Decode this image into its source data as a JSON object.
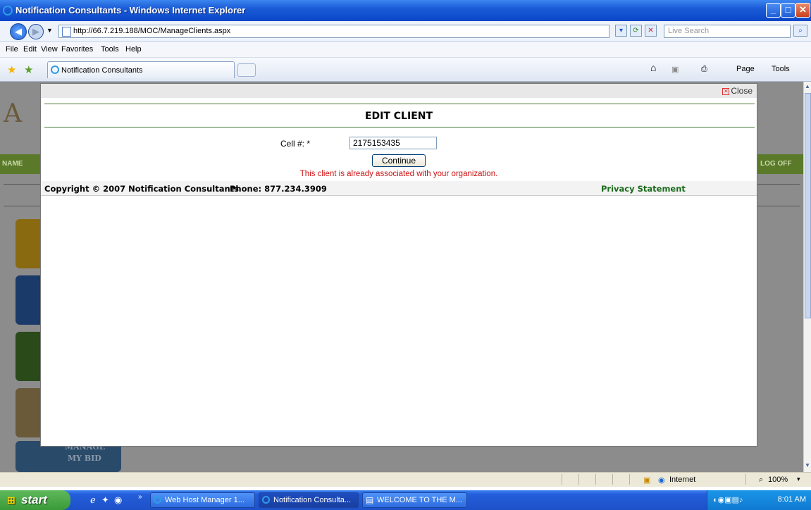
{
  "window": {
    "title": "Notification Consultants - Windows Internet Explorer",
    "minimize": "_",
    "maximize": "□",
    "close": "✕"
  },
  "addressbar": {
    "url": "http://66.7.219.188/MOC/ManageClients.aspx",
    "search_placeholder": "Live Search"
  },
  "menu": {
    "items": [
      "File",
      "Edit",
      "View",
      "Favorites",
      "Tools",
      "Help"
    ]
  },
  "tabs": {
    "active_label": "Notification Consultants"
  },
  "commandbar": {
    "page_label": "Page",
    "tools_label": "Tools"
  },
  "background_page": {
    "nav_left": "NAME",
    "logoff": "LOG OFF",
    "tile_label_1": "MANAGE",
    "tile_label_2": "MY BID"
  },
  "modal": {
    "close_label": "Close",
    "title": "EDIT CLIENT",
    "cell_label": "Cell #: *",
    "cell_value": "2175153435",
    "continue_label": "Continue",
    "error_message": "This client is already associated with your organization.",
    "footer": {
      "copyright": "Copyright © 2007 Notification Consultants",
      "phone": "Phone: 877.234.3909",
      "privacy": "Privacy Statement"
    }
  },
  "statusbar": {
    "zone": "Internet",
    "zoom": "100%"
  },
  "taskbar": {
    "start_label": "start",
    "items": [
      "Web Host Manager 1...",
      "Notification Consulta...",
      "WELCOME TO THE M..."
    ],
    "clock": "8:01 AM"
  },
  "colors": {
    "accent_green": "#1a6a1a",
    "error_red": "#cc1111",
    "xp_blue": "#245edb"
  }
}
